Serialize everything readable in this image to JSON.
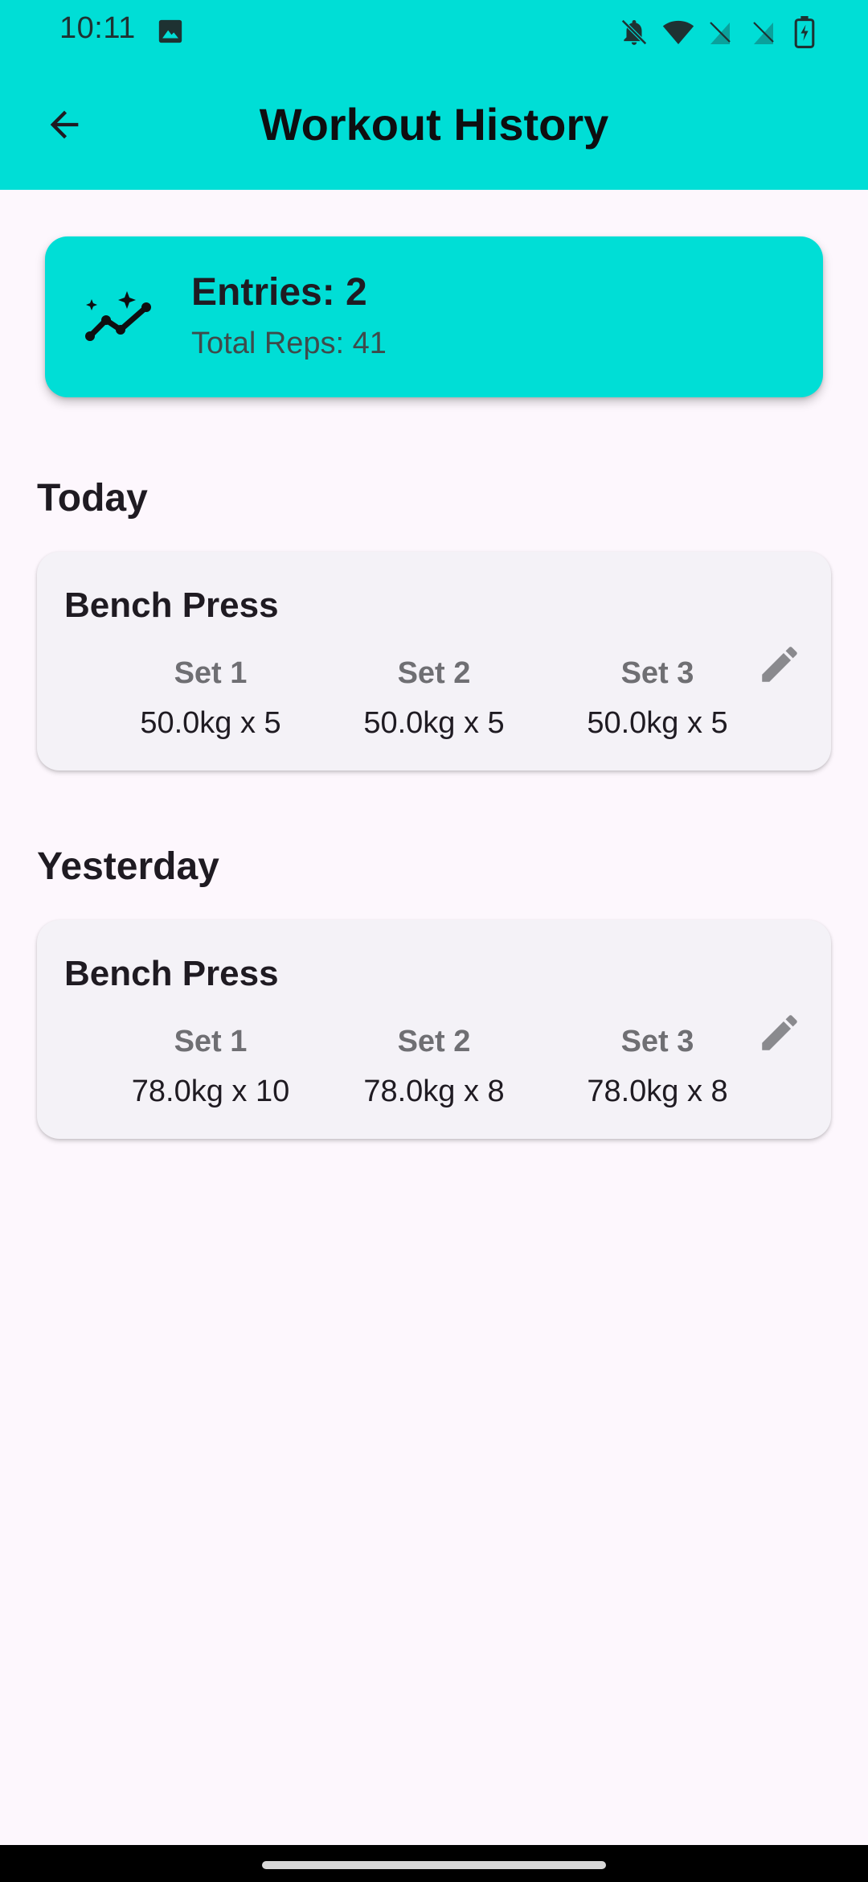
{
  "status_bar": {
    "time": "10:11",
    "icons": [
      "image-icon",
      "bell-off-icon",
      "wifi-icon",
      "no-sim-icon",
      "no-sim-icon",
      "battery-charging-icon"
    ]
  },
  "app_bar": {
    "title": "Workout History",
    "back_icon": "arrow-left-icon"
  },
  "summary": {
    "entries_text": "Entries: 2",
    "total_reps_text": "Total Reps: 41",
    "icon": "trending-sparkle-icon"
  },
  "sections": [
    {
      "title": "Today",
      "card": {
        "exercise": "Bench Press",
        "sets": [
          {
            "label": "Set 1",
            "value": "50.0kg x 5"
          },
          {
            "label": "Set 2",
            "value": "50.0kg x 5"
          },
          {
            "label": "Set 3",
            "value": "50.0kg x 5"
          }
        ],
        "edit_icon": "pencil-icon"
      }
    },
    {
      "title": "Yesterday",
      "card": {
        "exercise": "Bench Press",
        "sets": [
          {
            "label": "Set 1",
            "value": "78.0kg x 10"
          },
          {
            "label": "Set 2",
            "value": "78.0kg x 8"
          },
          {
            "label": "Set 3",
            "value": "78.0kg x 8"
          }
        ],
        "edit_icon": "pencil-icon"
      }
    }
  ],
  "colors": {
    "accent": "#00DED6",
    "background": "#FDF7FD",
    "card": "#F4F2F7",
    "muted_text": "#6F6F73"
  }
}
